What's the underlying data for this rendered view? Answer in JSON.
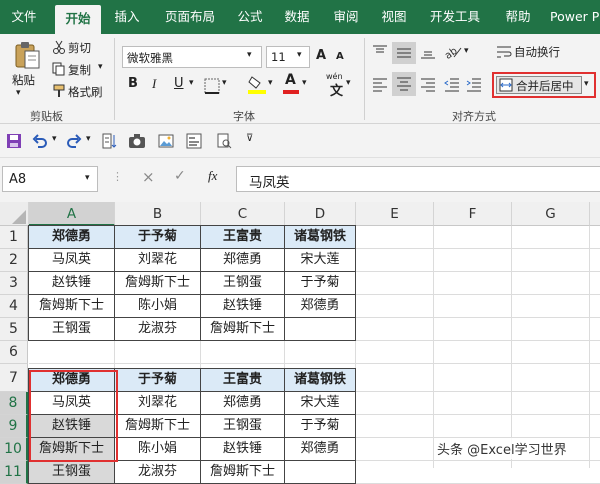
{
  "tabs": [
    "文件",
    "开始",
    "插入",
    "页面布局",
    "公式",
    "数据",
    "审阅",
    "视图",
    "开发工具",
    "帮助",
    "Power P"
  ],
  "clipboard": {
    "paste": "粘贴",
    "cut": "剪切",
    "copy": "复制",
    "format_painter": "格式刷",
    "group": "剪贴板"
  },
  "font": {
    "name": "微软雅黑",
    "size": "11",
    "group": "字体",
    "bold": "B",
    "italic": "I",
    "underline": "U",
    "grow": "A",
    "shrink": "A",
    "font_color": "A",
    "pinyin": "wén"
  },
  "alignment": {
    "wrap": "自动换行",
    "merge": "合并后居中",
    "group": "对齐方式"
  },
  "formula_bar": {
    "name_box": "A8",
    "cancel": "×",
    "enter": "✓",
    "fx": "fx",
    "content": "马凤英"
  },
  "columns": [
    "A",
    "B",
    "C",
    "D",
    "E",
    "F",
    "G"
  ],
  "rows": [
    "1",
    "2",
    "3",
    "4",
    "5",
    "6",
    "7",
    "8",
    "9",
    "10",
    "11"
  ],
  "table1": {
    "headers": [
      "郑德勇",
      "于予菊",
      "王富贵",
      "诸葛钢铁"
    ],
    "rows": [
      [
        "马凤英",
        "刘翠花",
        "郑德勇",
        "宋大莲"
      ],
      [
        "赵铁锤",
        "詹姆斯下士",
        "王钢蛋",
        "于予菊"
      ],
      [
        "詹姆斯下士",
        "陈小娟",
        "赵铁锤",
        "郑德勇"
      ],
      [
        "王钢蛋",
        "龙淑芬",
        "詹姆斯下士",
        ""
      ]
    ]
  },
  "table2": {
    "headers": [
      "郑德勇",
      "于予菊",
      "王富贵",
      "诸葛钢铁"
    ],
    "rows": [
      [
        "马凤英",
        "刘翠花",
        "郑德勇",
        "宋大莲"
      ],
      [
        "赵铁锤",
        "詹姆斯下士",
        "王钢蛋",
        "于予菊"
      ],
      [
        "詹姆斯下士",
        "陈小娟",
        "赵铁锤",
        "郑德勇"
      ],
      [
        "王钢蛋",
        "龙淑芬",
        "詹姆斯下士",
        ""
      ]
    ]
  },
  "watermark": "头条 @Excel学习世界",
  "colors": {
    "excel_green": "#217346",
    "header_fill": "#dbeaf7",
    "highlight_red": "#e03030",
    "selected_gray": "#d9d9d9"
  }
}
